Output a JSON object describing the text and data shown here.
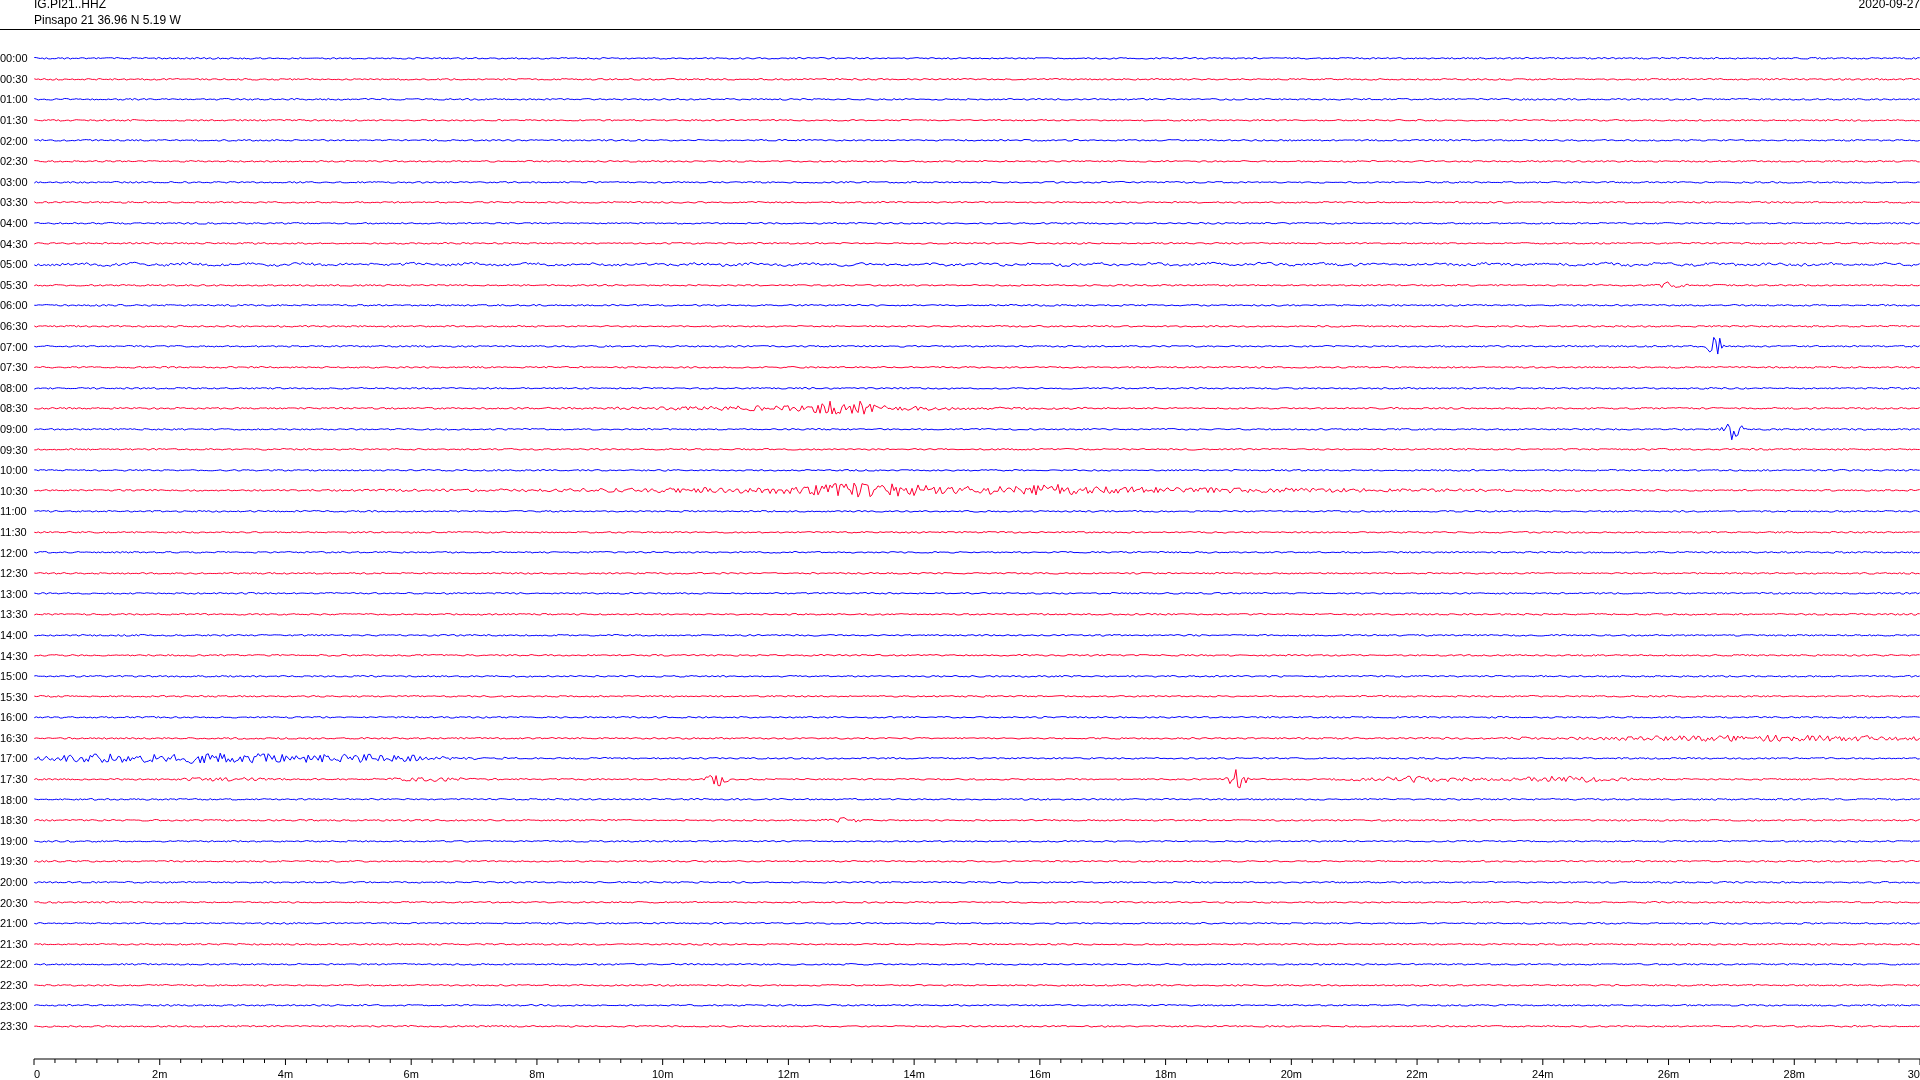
{
  "header": {
    "station": "IG.PI21..HHZ",
    "location": "Pinsapo 21  36.96 N 5.19 W",
    "date": "2020-09-27"
  },
  "traces": [
    {
      "time": "00:00",
      "color": "#0000ff"
    },
    {
      "time": "00:30",
      "color": "#ff0033"
    },
    {
      "time": "01:00",
      "color": "#0000ff"
    },
    {
      "time": "01:30",
      "color": "#ff0033"
    },
    {
      "time": "02:00",
      "color": "#0000ff"
    },
    {
      "time": "02:30",
      "color": "#ff0033"
    },
    {
      "time": "03:00",
      "color": "#0000ff"
    },
    {
      "time": "03:30",
      "color": "#ff0033"
    },
    {
      "time": "04:00",
      "color": "#0000ff"
    },
    {
      "time": "04:30",
      "color": "#ff0033"
    },
    {
      "time": "05:00",
      "color": "#0000ff"
    },
    {
      "time": "05:30",
      "color": "#ff0033"
    },
    {
      "time": "06:00",
      "color": "#0000ff"
    },
    {
      "time": "06:30",
      "color": "#ff0033"
    },
    {
      "time": "07:00",
      "color": "#0000ff"
    },
    {
      "time": "07:30",
      "color": "#ff0033"
    },
    {
      "time": "08:00",
      "color": "#0000ff"
    },
    {
      "time": "08:30",
      "color": "#ff0033"
    },
    {
      "time": "09:00",
      "color": "#0000ff"
    },
    {
      "time": "09:30",
      "color": "#ff0033"
    },
    {
      "time": "10:00",
      "color": "#0000ff"
    },
    {
      "time": "10:30",
      "color": "#ff0033"
    },
    {
      "time": "11:00",
      "color": "#0000ff"
    },
    {
      "time": "11:30",
      "color": "#ff0033"
    },
    {
      "time": "12:00",
      "color": "#0000ff"
    },
    {
      "time": "12:30",
      "color": "#ff0033"
    },
    {
      "time": "13:00",
      "color": "#0000ff"
    },
    {
      "time": "13:30",
      "color": "#ff0033"
    },
    {
      "time": "14:00",
      "color": "#0000ff"
    },
    {
      "time": "14:30",
      "color": "#ff0033"
    },
    {
      "time": "15:00",
      "color": "#0000ff"
    },
    {
      "time": "15:30",
      "color": "#ff0033"
    },
    {
      "time": "16:00",
      "color": "#0000ff"
    },
    {
      "time": "16:30",
      "color": "#ff0033"
    },
    {
      "time": "17:00",
      "color": "#0000ff"
    },
    {
      "time": "17:30",
      "color": "#ff0033"
    },
    {
      "time": "18:00",
      "color": "#0000ff"
    },
    {
      "time": "18:30",
      "color": "#ff0033"
    },
    {
      "time": "19:00",
      "color": "#0000ff"
    },
    {
      "time": "19:30",
      "color": "#ff0033"
    },
    {
      "time": "20:00",
      "color": "#0000ff"
    },
    {
      "time": "20:30",
      "color": "#ff0033"
    },
    {
      "time": "21:00",
      "color": "#0000ff"
    },
    {
      "time": "21:30",
      "color": "#ff0033"
    },
    {
      "time": "22:00",
      "color": "#0000ff"
    },
    {
      "time": "22:30",
      "color": "#ff0033"
    },
    {
      "time": "23:00",
      "color": "#0000ff"
    },
    {
      "time": "23:30",
      "color": "#ff0033"
    }
  ],
  "axis": {
    "ticks": [
      "0",
      "2m",
      "4m",
      "6m",
      "8m",
      "10m",
      "12m",
      "14m",
      "16m",
      "18m",
      "20m",
      "22m",
      "24m",
      "26m",
      "28m",
      "30"
    ]
  }
}
